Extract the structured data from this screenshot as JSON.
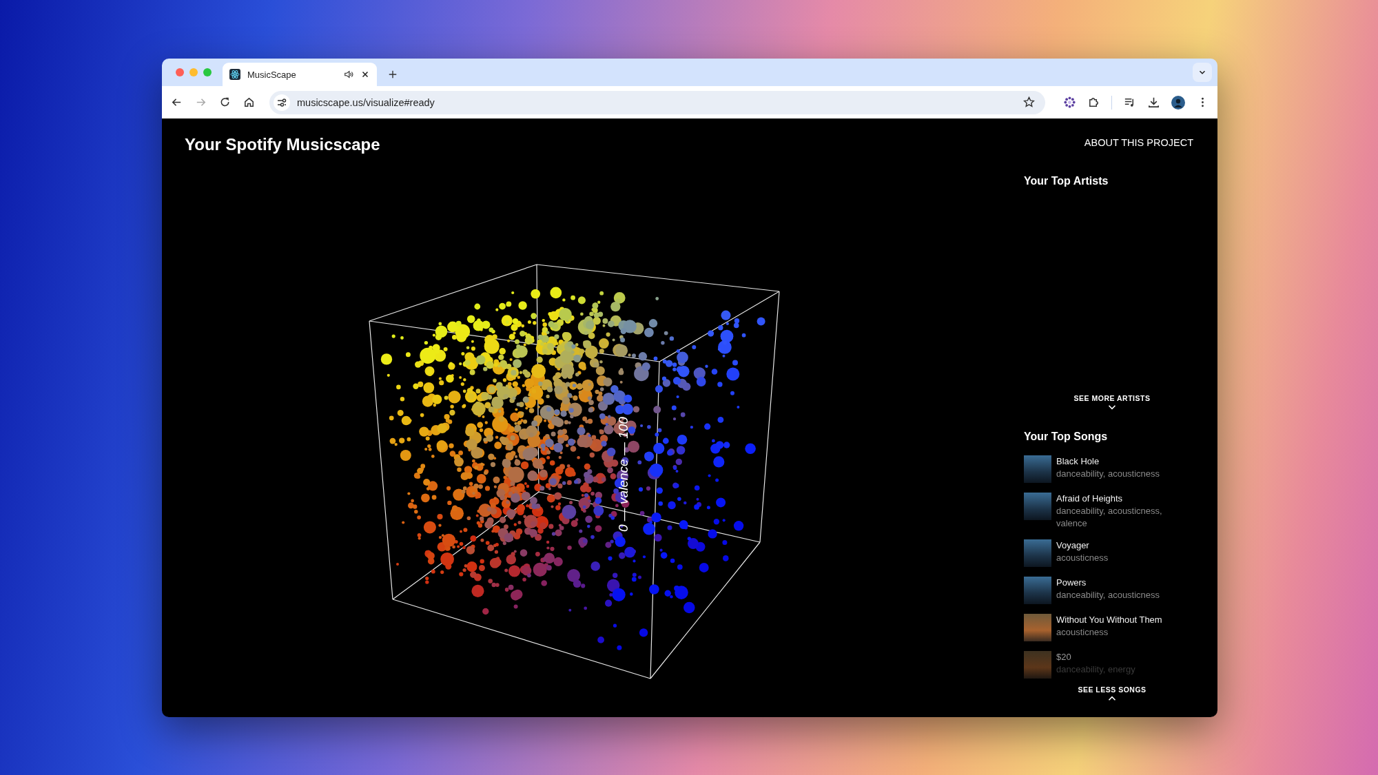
{
  "browser": {
    "tab": {
      "title": "MusicScape",
      "selected": true
    },
    "url": "musicscape.us/visualize#ready"
  },
  "page": {
    "title": "Your Spotify Musicscape",
    "about_link": "ABOUT THIS PROJECT"
  },
  "chart": {
    "axis_label": "0 — valence — 100"
  },
  "artists": {
    "heading": "Your Top Artists",
    "toggle": "SEE MORE ARTISTS"
  },
  "songs": {
    "heading": "Your Top Songs",
    "toggle": "SEE LESS SONGS",
    "items": [
      {
        "title": "Black Hole",
        "features": "danceability, acousticness"
      },
      {
        "title": "Afraid of Heights",
        "features": "danceability, acousticness, valence"
      },
      {
        "title": "Voyager",
        "features": "acousticness"
      },
      {
        "title": "Powers",
        "features": "danceability, acousticness"
      },
      {
        "title": "Without You Without Them",
        "features": "acousticness"
      },
      {
        "title": "$20",
        "features": "danceability, energy"
      }
    ]
  }
}
